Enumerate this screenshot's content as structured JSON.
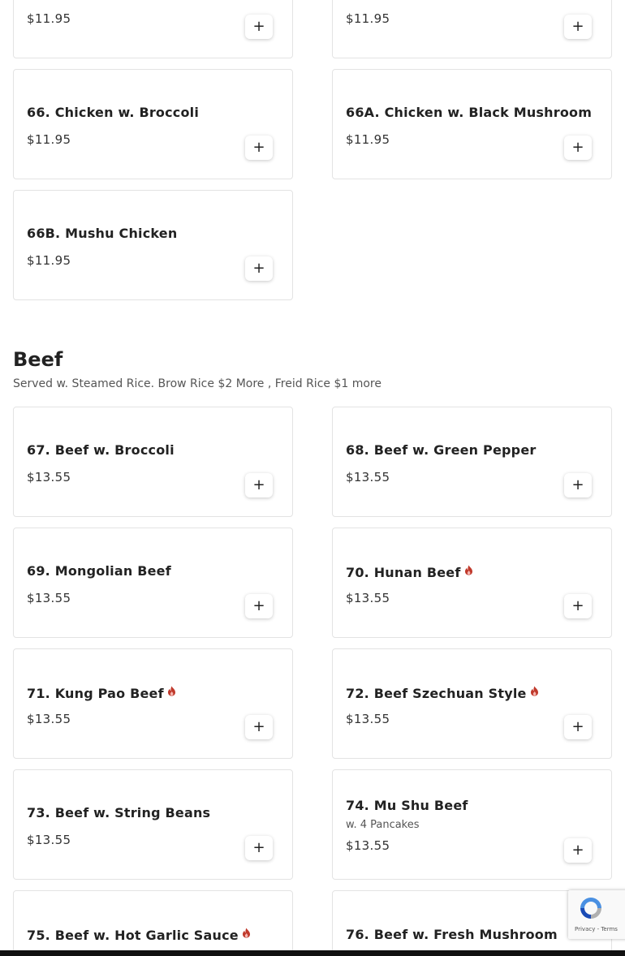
{
  "poultry_items": [
    {
      "name": "",
      "price": "$11.95"
    },
    {
      "name": "",
      "price": "$11.95"
    },
    {
      "name": "66. Chicken w. Broccoli",
      "price": "$11.95"
    },
    {
      "name": "66A. Chicken w. Black Mushroom",
      "price": "$11.95"
    },
    {
      "name": "66B. Mushu Chicken",
      "price": "$11.95"
    }
  ],
  "beef_section": {
    "title": "Beef",
    "description": "Served w. Steamed Rice. Brow Rice $2 More , Freid Rice $1 more",
    "items": [
      {
        "name": "67. Beef w. Broccoli",
        "price": "$13.55",
        "spicy": false
      },
      {
        "name": "68. Beef w. Green Pepper",
        "price": "$13.55",
        "spicy": false
      },
      {
        "name": "69. Mongolian Beef",
        "price": "$13.55",
        "spicy": false
      },
      {
        "name": "70. Hunan Beef",
        "price": "$13.55",
        "spicy": true
      },
      {
        "name": "71. Kung Pao Beef",
        "price": "$13.55",
        "spicy": true
      },
      {
        "name": "72. Beef Szechuan Style",
        "price": "$13.55",
        "spicy": true
      },
      {
        "name": "73. Beef w. String Beans",
        "price": "$13.55",
        "spicy": false
      },
      {
        "name": "74. Mu Shu Beef",
        "description": "w. 4 Pancakes",
        "price": "$13.55",
        "spicy": false
      },
      {
        "name": "75. Beef w. Hot Garlic Sauce",
        "spicy": true
      },
      {
        "name": "76. Beef w. Fresh Mushroom",
        "spicy": false
      }
    ]
  },
  "add_button_label": "+",
  "spicy_icon": "flame-icon",
  "spicy_color": "#c0392b",
  "recaptcha": {
    "links": "Privacy - Terms"
  }
}
